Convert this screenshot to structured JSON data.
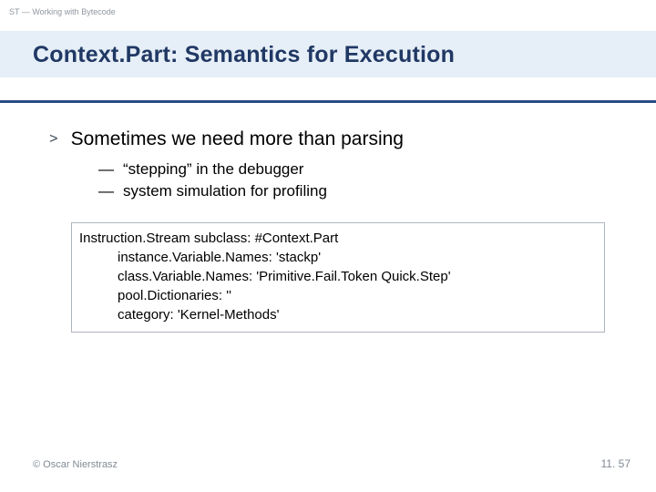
{
  "crumb": "ST — Working with Bytecode",
  "title": "Context.Part: Semantics for Execution",
  "main_point": "Sometimes we need more than parsing",
  "sub_points": [
    "“stepping” in the debugger",
    "system simulation for profiling"
  ],
  "code": {
    "l1": "Instruction.Stream subclass: #Context.Part",
    "l2": "instance.Variable.Names: 'stackp'",
    "l3": "class.Variable.Names: 'Primitive.Fail.Token Quick.Step'",
    "l4": "pool.Dictionaries: ''",
    "l5": "category: 'Kernel-Methods'"
  },
  "footer_left": "© Oscar Nierstrasz",
  "footer_right": "11. 57"
}
